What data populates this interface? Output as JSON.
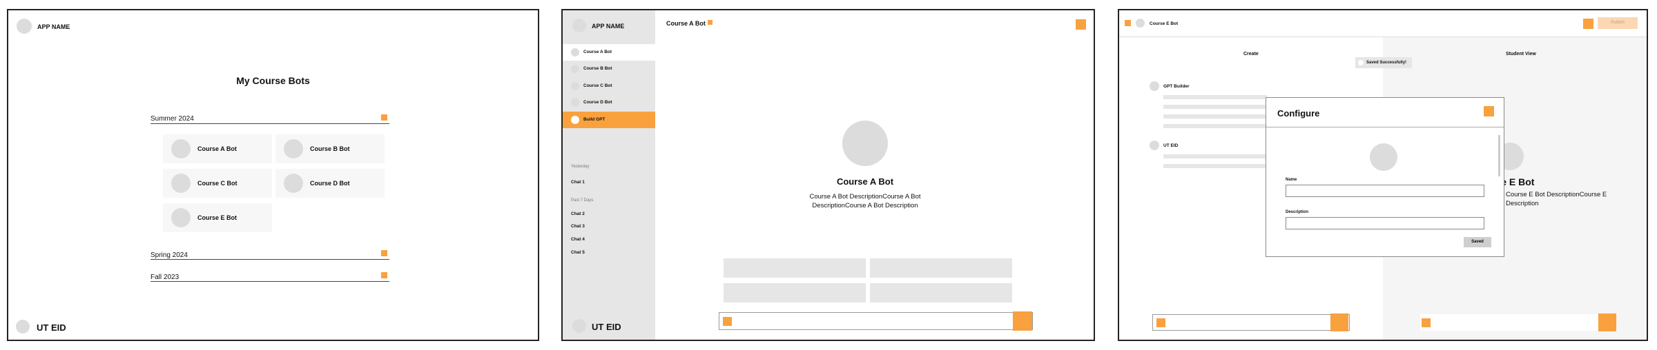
{
  "frame1": {
    "app_name": "APP NAME",
    "title": "My Course Bots",
    "semesters": [
      {
        "label": "Summer 2024"
      },
      {
        "label": "Spring 2024"
      },
      {
        "label": "Fall 2023"
      }
    ],
    "bots": [
      "Course A Bot",
      "Course B Bot",
      "Course C Bot",
      "Course D Bot",
      "Course E Bot"
    ],
    "footer_label": "UT EID"
  },
  "frame2": {
    "app_name": "APP NAME",
    "sidebar_items": [
      "Course A Bot",
      "Course B Bot",
      "Course C Bot",
      "Course D Bot",
      "Build GPT"
    ],
    "groups": {
      "yesterday": "Yesterday",
      "past7": "Past 7 Days"
    },
    "chats_yesterday": [
      "Chat 1"
    ],
    "chats_past7": [
      "Chat 2",
      "Chat 3",
      "Chat 4",
      "Chat 5"
    ],
    "footer_label": "UT EID",
    "top_title": "Course A Bot",
    "bot_name": "Course A Bot",
    "bot_description": "Course A Bot DescriptionCourse A Bot DescriptionCourse A Bot Description"
  },
  "frame3": {
    "title": "Course E Bot",
    "publish_label": "Publish",
    "create_tab": "Create",
    "student_view_tab": "Student View",
    "toast": "Saved Successfully!",
    "gpt_builder_label": "GPT Builder",
    "uteid_label": "UT EID",
    "preview_name": "rse E Bot",
    "preview_description": "Course E Bot DescriptionCourse E Description",
    "modal": {
      "title": "Configure",
      "name_label": "Name",
      "description_label": "Description",
      "saved_button": "Saved"
    }
  },
  "colors": {
    "accent": "#f9a13e",
    "placeholder_gray": "#e6e6e6",
    "avatar_gray": "#dcdcdc",
    "publish_disabled": "#fbd8b3"
  },
  "icons": {
    "avatar": "avatar-circle",
    "action": "orange-square-icon"
  }
}
